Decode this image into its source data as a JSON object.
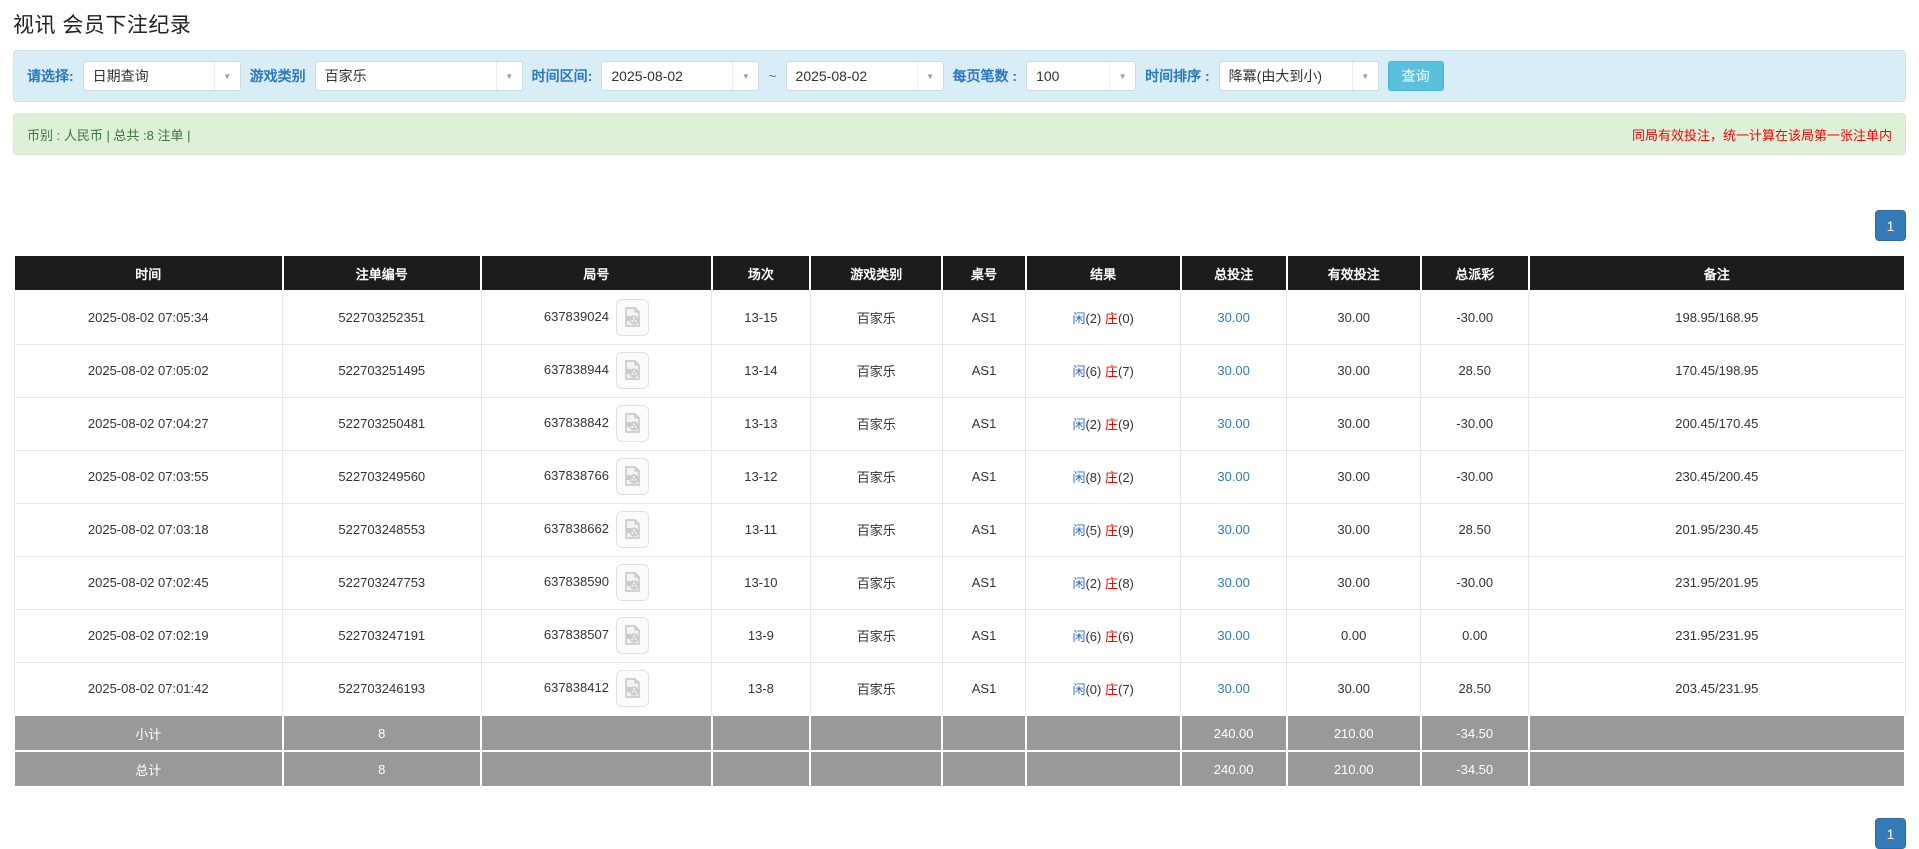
{
  "page": {
    "title": "视讯 会员下注纪录"
  },
  "filters": {
    "select_label": "请选择:",
    "select_value": "日期查询",
    "game_label": "游戏类别",
    "game_value": "百家乐",
    "range_label": "时间区间:",
    "date_from": "2025-08-02",
    "tilde": "~",
    "date_to": "2025-08-02",
    "per_page_label": "每页笔数 :",
    "per_page_value": "100",
    "sort_label": "时间排序 :",
    "sort_value": "降冪(由大到小)",
    "search_button": "查询"
  },
  "summary_bar": {
    "left_text": "币别 : 人民币 | 总共 :8 注单 |",
    "right_note": "同局有效投注，统一计算在该局第一张注单内"
  },
  "pagination": {
    "page": "1"
  },
  "icons": {
    "video_icon": "video-replay-icon",
    "dropdown_arrow": "▼"
  },
  "table": {
    "columns": [
      "时间",
      "注单编号",
      "局号",
      "场次",
      "游戏类别",
      "桌号",
      "结果",
      "总投注",
      "有效投注",
      "总派彩",
      "备注"
    ],
    "rows": [
      {
        "time": "2025-08-02 07:05:34",
        "bet_id": "522703252351",
        "round_id": "637839024",
        "session": "13-15",
        "game": "百家乐",
        "table_no": "AS1",
        "res_p": "闲",
        "res_p_n": "(2)",
        "res_b": "庄",
        "res_b_n": "(0)",
        "total_bet": "30.00",
        "valid_bet": "30.00",
        "payout": "-30.00",
        "payout_neg": true,
        "remark": "198.95/168.95"
      },
      {
        "time": "2025-08-02 07:05:02",
        "bet_id": "522703251495",
        "round_id": "637838944",
        "session": "13-14",
        "game": "百家乐",
        "table_no": "AS1",
        "res_p": "闲",
        "res_p_n": "(6)",
        "res_b": "庄",
        "res_b_n": "(7)",
        "total_bet": "30.00",
        "valid_bet": "30.00",
        "payout": "28.50",
        "payout_neg": false,
        "remark": "170.45/198.95"
      },
      {
        "time": "2025-08-02 07:04:27",
        "bet_id": "522703250481",
        "round_id": "637838842",
        "session": "13-13",
        "game": "百家乐",
        "table_no": "AS1",
        "res_p": "闲",
        "res_p_n": "(2)",
        "res_b": "庄",
        "res_b_n": "(9)",
        "total_bet": "30.00",
        "valid_bet": "30.00",
        "payout": "-30.00",
        "payout_neg": true,
        "remark": "200.45/170.45"
      },
      {
        "time": "2025-08-02 07:03:55",
        "bet_id": "522703249560",
        "round_id": "637838766",
        "session": "13-12",
        "game": "百家乐",
        "table_no": "AS1",
        "res_p": "闲",
        "res_p_n": "(8)",
        "res_b": "庄",
        "res_b_n": "(2)",
        "total_bet": "30.00",
        "valid_bet": "30.00",
        "payout": "-30.00",
        "payout_neg": true,
        "remark": "230.45/200.45"
      },
      {
        "time": "2025-08-02 07:03:18",
        "bet_id": "522703248553",
        "round_id": "637838662",
        "session": "13-11",
        "game": "百家乐",
        "table_no": "AS1",
        "res_p": "闲",
        "res_p_n": "(5)",
        "res_b": "庄",
        "res_b_n": "(9)",
        "total_bet": "30.00",
        "valid_bet": "30.00",
        "payout": "28.50",
        "payout_neg": false,
        "remark": "201.95/230.45"
      },
      {
        "time": "2025-08-02 07:02:45",
        "bet_id": "522703247753",
        "round_id": "637838590",
        "session": "13-10",
        "game": "百家乐",
        "table_no": "AS1",
        "res_p": "闲",
        "res_p_n": "(2)",
        "res_b": "庄",
        "res_b_n": "(8)",
        "total_bet": "30.00",
        "valid_bet": "30.00",
        "payout": "-30.00",
        "payout_neg": true,
        "remark": "231.95/201.95"
      },
      {
        "time": "2025-08-02 07:02:19",
        "bet_id": "522703247191",
        "round_id": "637838507",
        "session": "13-9",
        "game": "百家乐",
        "table_no": "AS1",
        "res_p": "闲",
        "res_p_n": "(6)",
        "res_b": "庄",
        "res_b_n": "(6)",
        "total_bet": "30.00",
        "valid_bet": "0.00",
        "payout": "0.00",
        "payout_neg": false,
        "remark": "231.95/231.95"
      },
      {
        "time": "2025-08-02 07:01:42",
        "bet_id": "522703246193",
        "round_id": "637838412",
        "session": "13-8",
        "game": "百家乐",
        "table_no": "AS1",
        "res_p": "闲",
        "res_p_n": "(0)",
        "res_b": "庄",
        "res_b_n": "(7)",
        "total_bet": "30.00",
        "valid_bet": "30.00",
        "payout": "28.50",
        "payout_neg": false,
        "remark": "203.45/231.95"
      }
    ],
    "subtotal": {
      "label": "小计",
      "count": "8",
      "total_bet": "240.00",
      "valid_bet": "210.00",
      "payout": "-34.50"
    },
    "total": {
      "label": "总计",
      "count": "8",
      "total_bet": "240.00",
      "valid_bet": "210.00",
      "payout": "-34.50"
    }
  }
}
